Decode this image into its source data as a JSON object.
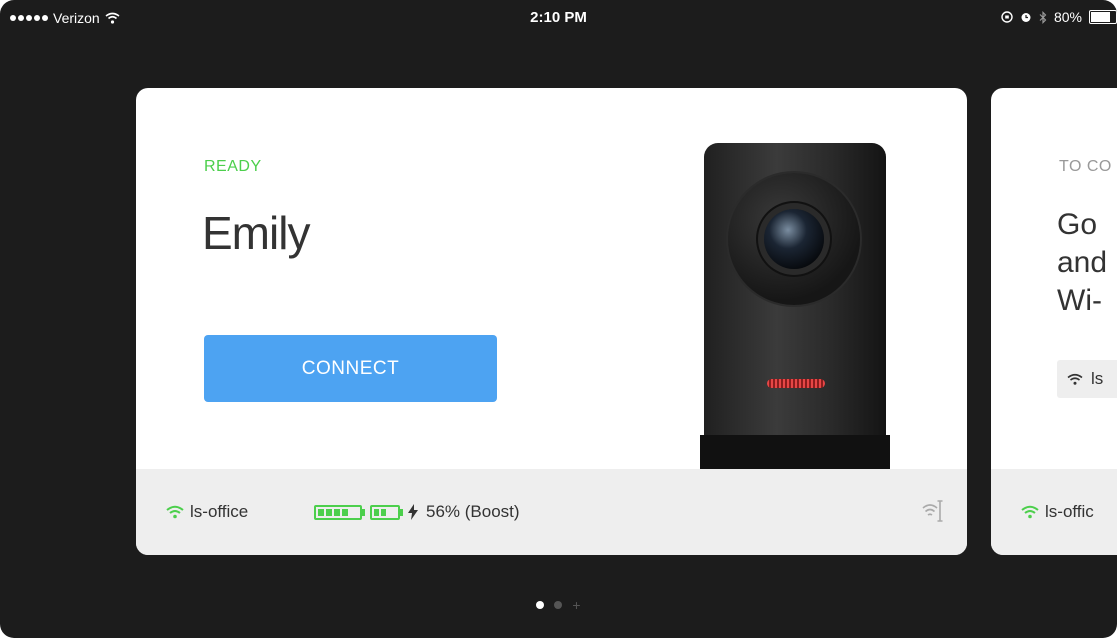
{
  "status_bar": {
    "carrier": "Verizon",
    "time": "2:10 PM",
    "battery_percent": "80%"
  },
  "cards": [
    {
      "status": "READY",
      "device_name": "Emily",
      "connect_label": "CONNECT",
      "wifi_network": "ls-office",
      "battery_text": "56% (Boost)"
    },
    {
      "status": "TO CO",
      "instruction": "Go \nand\nWi-",
      "network_chip": "ls",
      "wifi_network": "ls-offic"
    }
  ],
  "colors": {
    "ready_green": "#4ccf4c",
    "connect_blue": "#4da3f2",
    "background": "#1c1c1c",
    "footer_gray": "#eeeeee"
  },
  "pagination": {
    "total": 2,
    "active_index": 0,
    "has_add": true
  }
}
